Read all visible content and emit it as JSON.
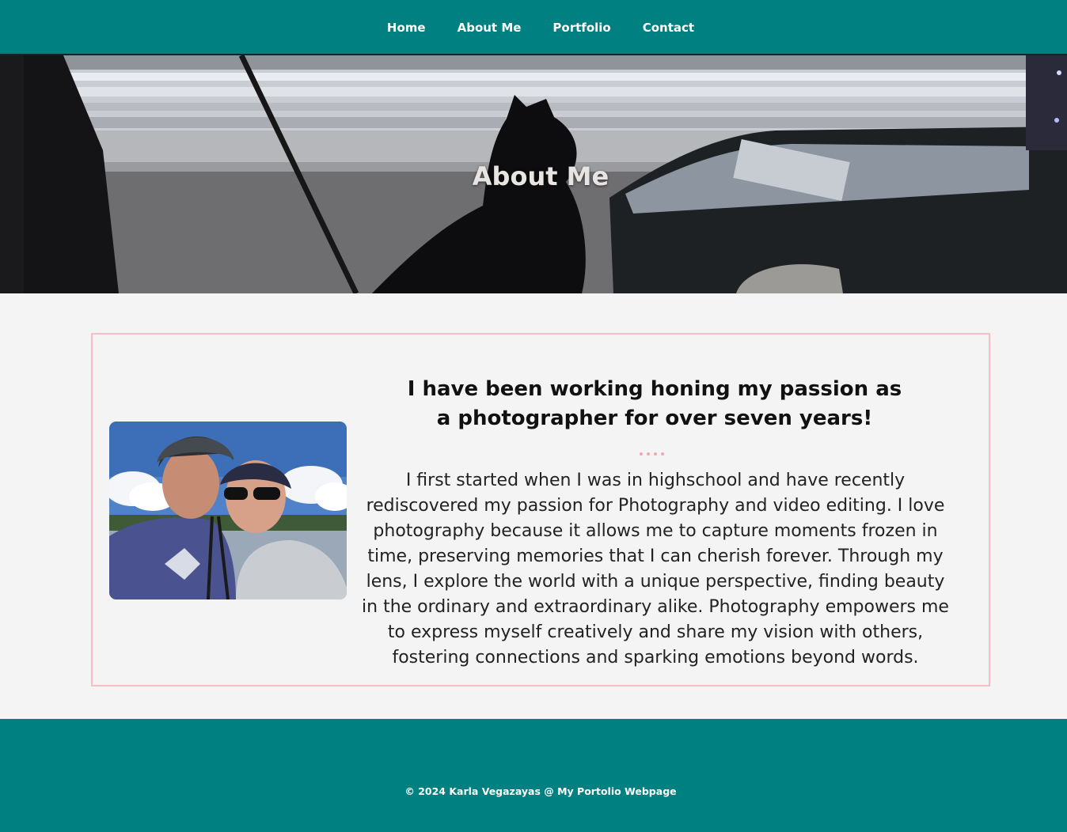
{
  "nav": {
    "items": [
      {
        "label": "Home"
      },
      {
        "label": "About Me"
      },
      {
        "label": "Portfolio"
      },
      {
        "label": "Contact"
      }
    ]
  },
  "hero": {
    "title": "About Me"
  },
  "about": {
    "heading": "I have been working honing my passion as a photographer for over seven years!",
    "body": "I first started when I was in highschool and have recently rediscovered my passion for Photography and video editing. I love photography because it allows me to capture moments frozen in time, preserving memories that I can cherish forever. Through my lens, I explore the world with a unique perspective, finding beauty in the ordinary and extraordinary alike. Photography empowers me to express myself creatively and share my vision with others, fostering connections and sparking emotions beyond words."
  },
  "footer": {
    "copyright": "© 2024 Karla Vegazayas @ My Portolio Webpage"
  },
  "colors": {
    "nav_bg": "#008080",
    "footer_bg": "#008080",
    "card_border": "#f6bfc6",
    "divider_dots": "#f4a6b0",
    "page_bg": "#f4f4f4"
  },
  "icons": {
    "divider": "dots-divider"
  }
}
